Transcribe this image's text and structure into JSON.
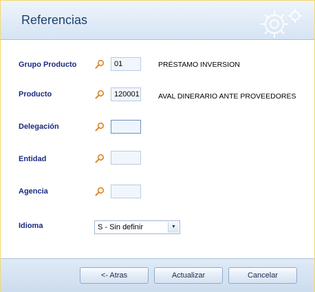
{
  "header": {
    "title": "Referencias"
  },
  "form": {
    "rows": [
      {
        "label": "Grupo Producto",
        "value": "01",
        "description": "PRÉSTAMO INVERSION"
      },
      {
        "label": "Producto",
        "value": "120001",
        "description": "AVAL DINERARIO ANTE PROVEEDORES"
      },
      {
        "label": "Delegación",
        "value": "",
        "description": ""
      },
      {
        "label": "Entidad",
        "value": "",
        "description": ""
      },
      {
        "label": "Agencia",
        "value": "",
        "description": ""
      }
    ],
    "idioma": {
      "label": "Idioma",
      "selected": "S - Sin definir"
    }
  },
  "footer": {
    "back_label": "<-  Atras",
    "update_label": "Actualizar",
    "cancel_label": "Cancelar"
  },
  "colors": {
    "label": "#1a2a80",
    "header_title": "#1f3f6e",
    "lookup_icon": "#d9862a",
    "window_border": "#f2d86a"
  },
  "icons": {
    "lookup": "magnifier-icon",
    "header_decoration": "gear-icon",
    "dropdown": "chevron-down-icon"
  }
}
